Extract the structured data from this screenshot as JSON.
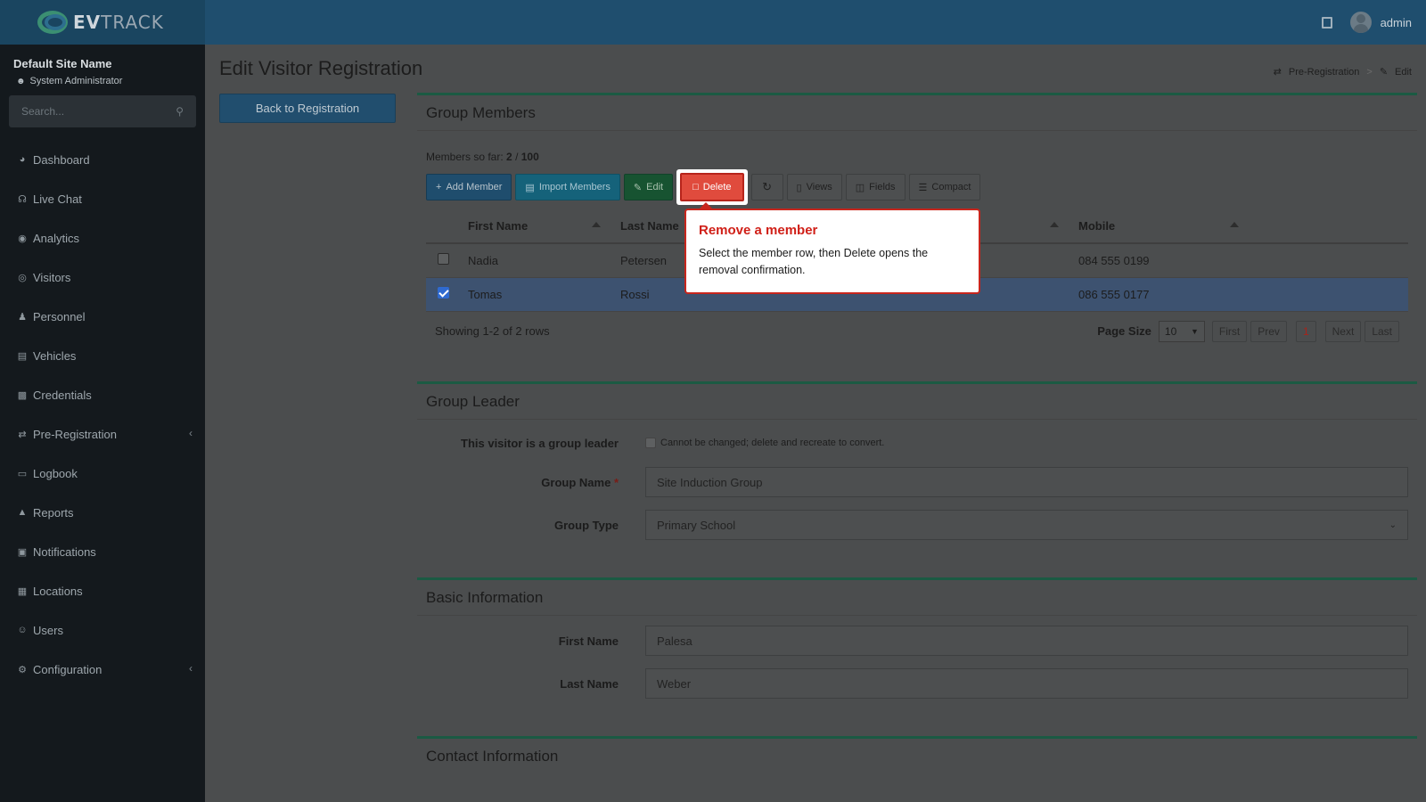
{
  "brand": {
    "name_bold": "EV",
    "name_rest": "TRACK"
  },
  "header": {
    "user": "admin"
  },
  "sidebar": {
    "site_name": "Default Site Name",
    "role": "System Administrator",
    "search_placeholder": "Search...",
    "items": [
      {
        "label": "Dashboard",
        "icon": "dashboard-icon"
      },
      {
        "label": "Live Chat",
        "icon": "headset-icon"
      },
      {
        "label": "Analytics",
        "icon": "target-icon"
      },
      {
        "label": "Visitors",
        "icon": "eye-icon"
      },
      {
        "label": "Personnel",
        "icon": "person-icon"
      },
      {
        "label": "Vehicles",
        "icon": "car-icon"
      },
      {
        "label": "Credentials",
        "icon": "badge-icon"
      },
      {
        "label": "Pre-Registration",
        "icon": "swap-icon"
      },
      {
        "label": "Logbook",
        "icon": "book-icon"
      },
      {
        "label": "Reports",
        "icon": "chart-icon"
      },
      {
        "label": "Notifications",
        "icon": "chat-icon"
      },
      {
        "label": "Locations",
        "icon": "map-icon"
      },
      {
        "label": "Users",
        "icon": "users-icon"
      },
      {
        "label": "Configuration",
        "icon": "gear-icon"
      }
    ]
  },
  "page": {
    "title": "Edit Visitor Registration",
    "breadcrumb": [
      "Pre-Registration",
      "Edit"
    ],
    "back_label": "Back to Registration"
  },
  "members": {
    "title": "Group Members",
    "count_label": "Members so far:",
    "count_current": "2",
    "count_max": "100",
    "toolbar": {
      "add": "Add Member",
      "import": "Import Members",
      "edit": "Edit",
      "delete": "Delete",
      "views": "Views",
      "fields": "Fields",
      "compact": "Compact"
    },
    "columns": [
      "First Name",
      "Last Name",
      "Mobile"
    ],
    "rows": [
      {
        "first": "Nadia",
        "last": "Petersen",
        "mobile": "084 555 0199",
        "checked": false
      },
      {
        "first": "Tomas",
        "last": "Rossi",
        "mobile": "086 555 0177",
        "checked": true
      }
    ],
    "showing": "Showing 1-2 of 2 rows",
    "page_size_label": "Page Size",
    "page_size": "10",
    "pager": {
      "first": "First",
      "prev": "Prev",
      "current": "1",
      "next": "Next",
      "last": "Last"
    }
  },
  "tooltip": {
    "title": "Remove a member",
    "body": "Select the member row, then Delete opens the removal confirmation."
  },
  "leader": {
    "title": "Group Leader",
    "is_leader_label": "This visitor is a group leader",
    "is_leader_note": "Cannot be changed; delete and recreate to convert.",
    "group_name_label": "Group Name",
    "group_name": "Site Induction Group",
    "group_type_label": "Group Type",
    "group_type": "Primary School"
  },
  "basic": {
    "title": "Basic Information",
    "first_label": "First Name",
    "first": "Palesa",
    "last_label": "Last Name",
    "last": "Weber"
  },
  "contact": {
    "title": "Contact Information"
  }
}
